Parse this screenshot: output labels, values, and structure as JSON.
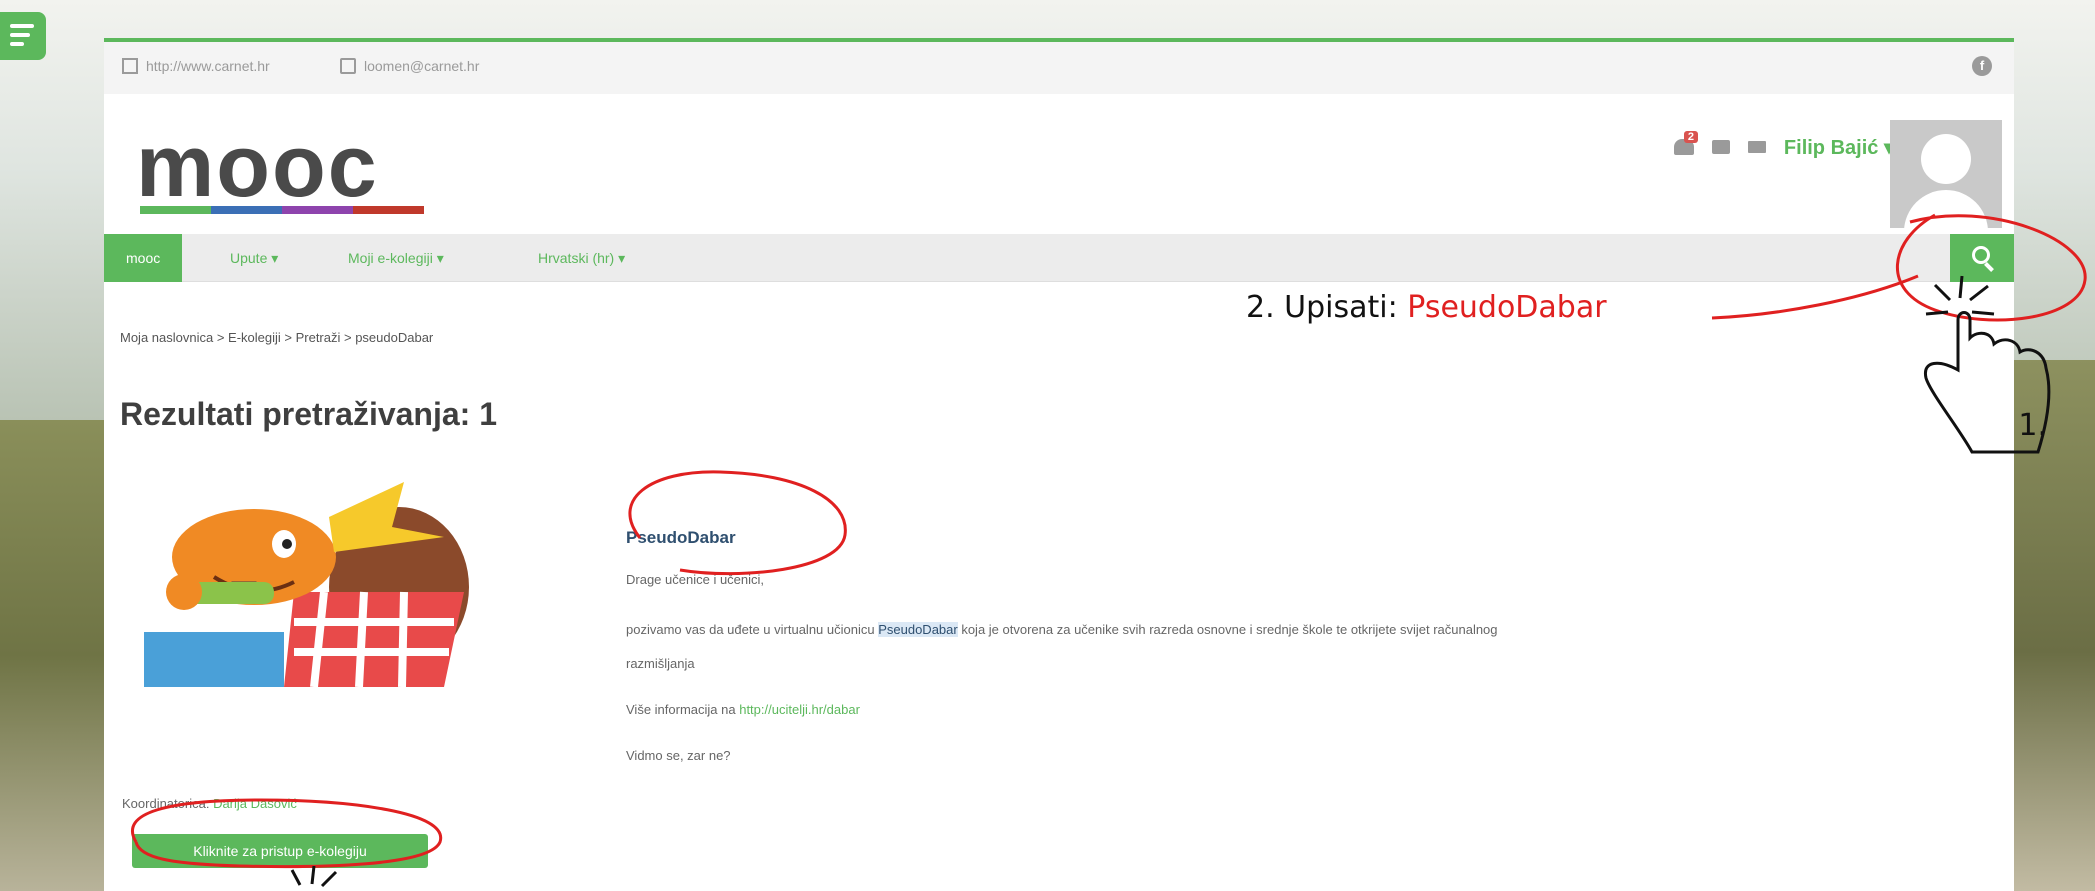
{
  "topbar": {
    "website": "http://www.carnet.hr",
    "email": "loomen@carnet.hr"
  },
  "logo": {
    "text": "mooc"
  },
  "colors": {
    "accent": "#5cb85c",
    "annotation": "#e02020",
    "badge": "#d9534f",
    "logo_stripes": [
      "#5cb85c",
      "#3b6fb6",
      "#8e44ad",
      "#c0392b"
    ]
  },
  "user": {
    "notifications_count": "2",
    "name": "Filip Bajić",
    "icons": [
      "bell-icon",
      "chat-icon",
      "envelope-icon",
      "avatar"
    ]
  },
  "nav": {
    "items": [
      {
        "label": "mooc"
      },
      {
        "label": "Upute ▾"
      },
      {
        "label": "Moji e-kolegiji ▾"
      },
      {
        "label": "Hrvatski (hr) ▾"
      }
    ]
  },
  "breadcrumb": "Moja naslovnica > E-kolegiji > Pretraži > pseudoDabar",
  "page_title": "Rezultati pretraživanja: 1",
  "course": {
    "name": "PseudoDabar",
    "greeting": "Drage učenice i učenici,",
    "body_before": "pozivamo vas da uđete u virtualnu učionicu ",
    "body_highlight": "PseudoDabar",
    "body_after": " koja je otvorena za učenike svih razreda osnovne i srednje škole te otkrijete svijet računalnog",
    "body_line2": "razmišljanja",
    "more_info_prefix": "Više informacija na ",
    "more_info_link": "http://ucitelji.hr/dabar",
    "closing": "Vidmo se, zar ne?",
    "coordinator_prefix": "Koordinatorica: ",
    "coordinator_name": "Darija Dasović",
    "enter_button": "Kliknite za pristup e-kolegiju"
  },
  "annotations": {
    "step2_prefix": "2. Upisati:  ",
    "step2_term": "PseudoDabar",
    "step1": "1."
  }
}
